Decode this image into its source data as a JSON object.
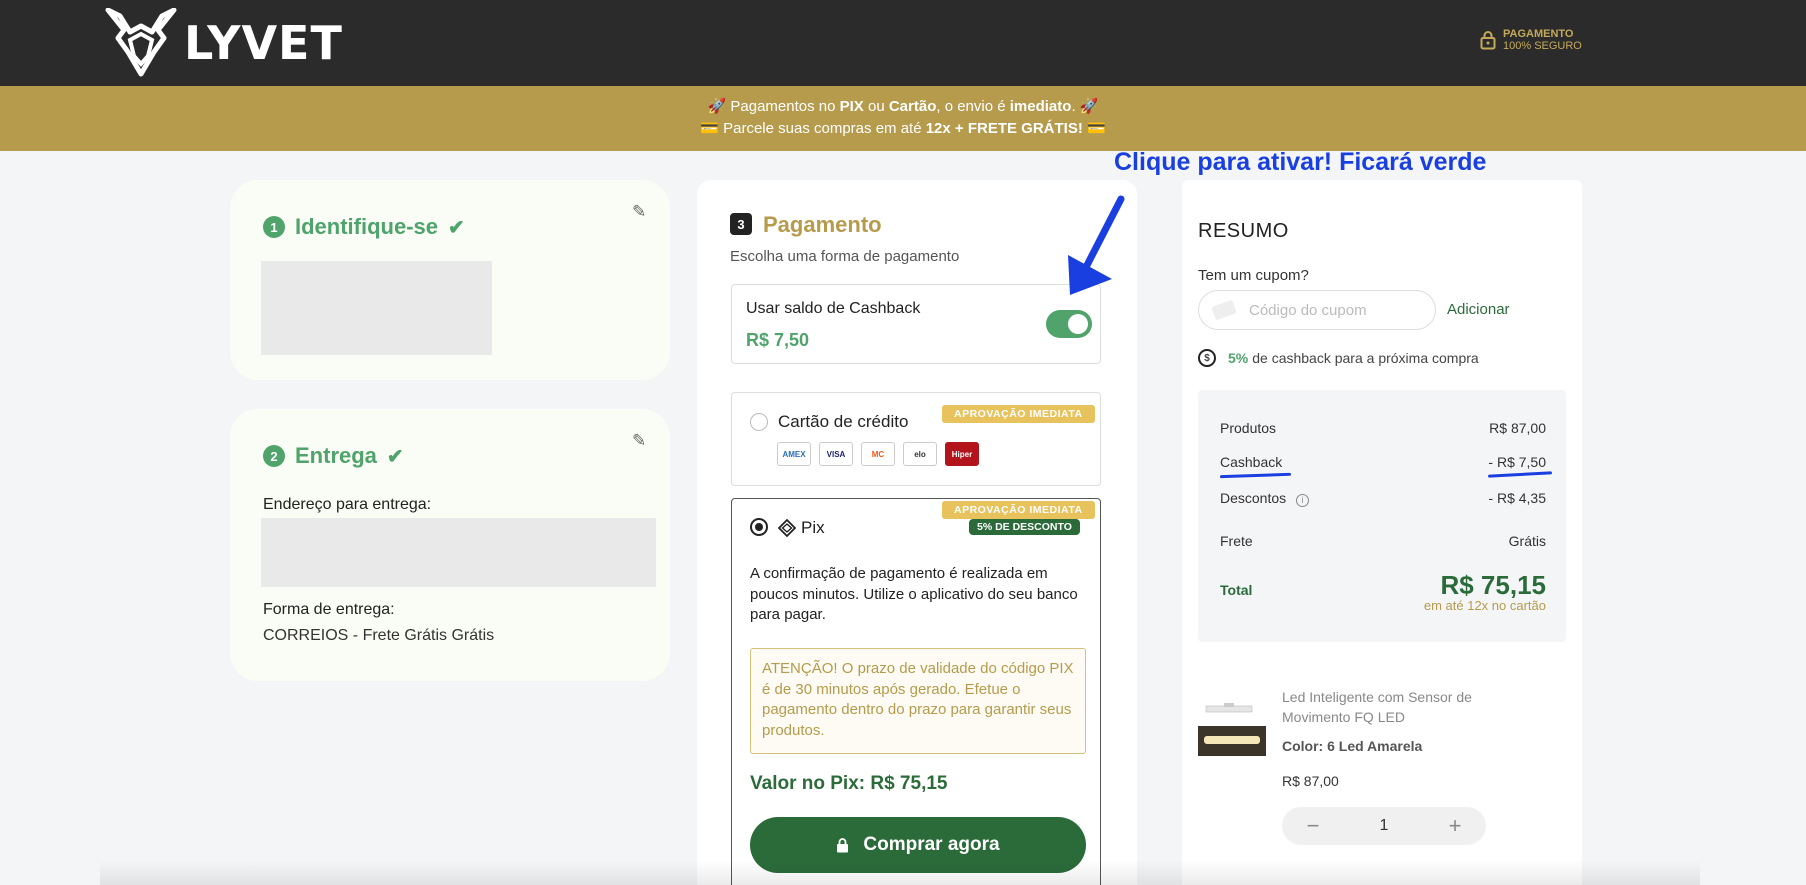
{
  "header": {
    "logo_text": "LYVET",
    "secure_line1": "PAGAMENTO",
    "secure_line2": "100% SEGURO"
  },
  "promo": {
    "line1_a": "🚀 Pagamentos no ",
    "line1_pix": "PIX",
    "line1_b": " ou ",
    "line1_card": "Cartão",
    "line1_c": ", o envio é ",
    "line1_imm": "imediato",
    "line1_d": ". 🚀",
    "line2_a": "💳 Parcele suas compras em até ",
    "line2_b": "12x + FRETE GRÁTIS!",
    "line2_c": " 💳"
  },
  "step1": {
    "num": "1",
    "title": "Identifique-se"
  },
  "step2": {
    "num": "2",
    "title": "Entrega",
    "address_label": "Endereço para entrega:",
    "method_label": "Forma de entrega:",
    "method_value": "CORREIOS - Frete Grátis Grátis"
  },
  "payment": {
    "num": "3",
    "title": "Pagamento",
    "subtitle": "Escolha uma forma de pagamento",
    "cashback_label": "Usar saldo de Cashback",
    "cashback_value": "R$ 7,50",
    "credit_label": "Cartão de crédito",
    "credit_badge": "APROVAÇÃO IMEDIATA",
    "card_brands": [
      "AMEX",
      "VISA",
      "MC",
      "elo",
      "Hiper"
    ],
    "pix_label": "Pix",
    "pix_badge": "APROVAÇÃO IMEDIATA",
    "pix_discount": "5% DE DESCONTO",
    "pix_desc": "A confirmação de pagamento é realizada em poucos minutos. Utilize o aplicativo do seu banco para pagar.",
    "pix_warning": "ATENÇÃO! O prazo de validade do código PIX é de 30 minutos após gerado. Efetue o pagamento dentro do prazo para garantir seus produtos.",
    "pix_value": "Valor no Pix: R$ 75,15",
    "buy_button": "Comprar agora"
  },
  "annotation": "Clique para ativar! Ficará verde",
  "summary": {
    "title": "RESUMO",
    "coupon_question": "Tem um cupom?",
    "coupon_placeholder": "Código do cupom",
    "coupon_add": "Adicionar",
    "cashback_pct": "5%",
    "cashback_text": "de cashback para a próxima compra",
    "rows": [
      {
        "label": "Produtos",
        "value": "R$ 87,00"
      },
      {
        "label": "Cashback",
        "value": "- R$ 7,50"
      },
      {
        "label": "Descontos",
        "value": "- R$ 4,35"
      },
      {
        "label": "Frete",
        "value": "Grátis"
      }
    ],
    "total_label": "Total",
    "total_value": "R$ 75,15",
    "total_sub": "em até 12x no cartão"
  },
  "product": {
    "name": "Led Inteligente com Sensor de Movimento FQ LED",
    "color": "Color: 6 Led Amarela",
    "price": "R$ 87,00",
    "qty": "1"
  },
  "colors": {
    "green": "#4fa36b",
    "dark_green": "#2b6b3a",
    "gold": "#b69b4c",
    "annotation_blue": "#1a3fe0"
  }
}
